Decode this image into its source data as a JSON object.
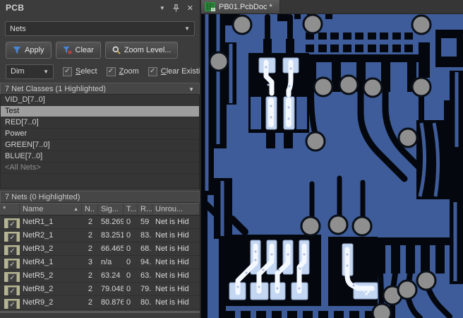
{
  "icons": {
    "dropdown_arrow": "▼",
    "sort_asc": "▲",
    "check": "✓",
    "close": "✕"
  },
  "panel": {
    "title": "PCB",
    "view_selector": {
      "value": "Nets"
    },
    "toolbar": {
      "apply_label": "Apply",
      "clear_label": "Clear",
      "zoom_level_label": "Zoom Level..."
    },
    "highlight_mode": {
      "value": "Dim"
    },
    "options": [
      {
        "label": "Select",
        "checked": true
      },
      {
        "label": "Zoom",
        "checked": true
      },
      {
        "label": "Clear Existing",
        "checked": true
      }
    ],
    "net_classes": {
      "header": "7 Net Classes (1 Highlighted)",
      "items": [
        {
          "label": "VID_D[7..0]",
          "selected": false
        },
        {
          "label": "Test",
          "selected": true
        },
        {
          "label": "RED[7..0]",
          "selected": false
        },
        {
          "label": "Power",
          "selected": false
        },
        {
          "label": "GREEN[7..0]",
          "selected": false
        },
        {
          "label": "BLUE[7..0]",
          "selected": false
        },
        {
          "label": "<All Nets>",
          "selected": false
        }
      ]
    },
    "nets": {
      "header": "7 Nets (0 Highlighted)",
      "columns": [
        "*",
        "Name",
        "N..",
        "Sig...",
        "T...",
        "R...",
        "Unrou..."
      ],
      "sort": {
        "column": "Name",
        "direction": "ascending"
      },
      "rows": [
        {
          "enabled": true,
          "name": "NetR1_1",
          "nodes": "2",
          "signal": "58.269",
          "t": "0",
          "routed": "59",
          "unrouted": "Net is Hid"
        },
        {
          "enabled": true,
          "name": "NetR2_1",
          "nodes": "2",
          "signal": "83.251",
          "t": "0",
          "routed": "83.",
          "unrouted": "Net is Hid"
        },
        {
          "enabled": true,
          "name": "NetR3_2",
          "nodes": "2",
          "signal": "66.465",
          "t": "0",
          "routed": "68.",
          "unrouted": "Net is Hid"
        },
        {
          "enabled": true,
          "name": "NetR4_1",
          "nodes": "3",
          "signal": "n/a",
          "t": "0",
          "routed": "94.",
          "unrouted": "Net is Hid"
        },
        {
          "enabled": true,
          "name": "NetR5_2",
          "nodes": "2",
          "signal": "63.24",
          "t": "0",
          "routed": "63.",
          "unrouted": "Net is Hid"
        },
        {
          "enabled": true,
          "name": "NetR8_2",
          "nodes": "2",
          "signal": "79.048",
          "t": "0",
          "routed": "79.",
          "unrouted": "Net is Hid"
        },
        {
          "enabled": true,
          "name": "NetR9_2",
          "nodes": "2",
          "signal": "80.876",
          "t": "0",
          "routed": "80.",
          "unrouted": "Net is Hid"
        }
      ]
    }
  },
  "document": {
    "tab_label": "PB01.PcbDoc *"
  },
  "colors": {
    "pcb_copper_dim_blue": "#3d5c99",
    "pcb_plane_black": "#04070d",
    "via_gray": "#8f8f8f",
    "highlight_pad_blue": "#c3d6f2",
    "highlight_trace_white": "#f4f8ff",
    "selected_row_gray": "#9e9e9e",
    "filter_icon_blue": "#4a86d8",
    "tab_icon_green": "#2e8b3d"
  }
}
